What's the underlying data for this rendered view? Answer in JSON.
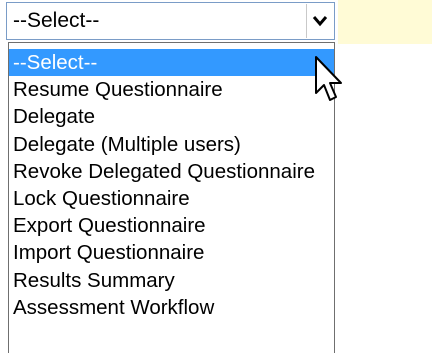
{
  "select": {
    "current_value": "--Select--",
    "arrow_icon": "chevron-down-icon",
    "options": [
      {
        "label": "--Select--",
        "selected": true
      },
      {
        "label": "Resume Questionnaire",
        "selected": false
      },
      {
        "label": "Delegate",
        "selected": false
      },
      {
        "label": "Delegate (Multiple users)",
        "selected": false
      },
      {
        "label": "Revoke Delegated Questionnaire",
        "selected": false
      },
      {
        "label": "Lock Questionnaire",
        "selected": false
      },
      {
        "label": "Export Questionnaire",
        "selected": false
      },
      {
        "label": "Import Questionnaire",
        "selected": false
      },
      {
        "label": "Results Summary",
        "selected": false
      },
      {
        "label": "Assessment Workflow",
        "selected": false
      }
    ]
  },
  "colors": {
    "highlight": "#3399ff",
    "border": "#7a9cc7",
    "page_strip": "#fffbd6"
  },
  "cursor_icon": "mouse-pointer-icon"
}
